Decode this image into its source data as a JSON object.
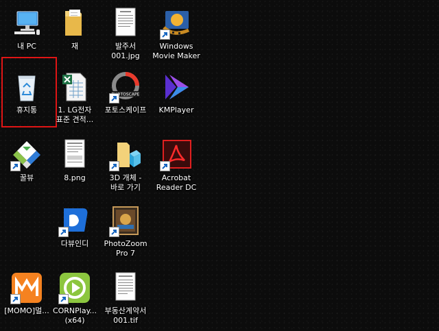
{
  "desktop": {
    "icons": [
      {
        "id": "this-pc",
        "label": "내 PC",
        "icon": "computer-icon"
      },
      {
        "id": "folder-jae",
        "label": "재",
        "icon": "folder-icon"
      },
      {
        "id": "balju",
        "label": "발주서\n001.jpg",
        "icon": "image-file-icon"
      },
      {
        "id": "movie-maker",
        "label": "Windows\nMovie Maker",
        "icon": "movie-maker-icon"
      },
      {
        "id": "recycle-bin",
        "label": "휴지통",
        "icon": "recycle-bin-icon"
      },
      {
        "id": "lg-xlsx",
        "label": "1. LG전자\n표준 견적...",
        "icon": "excel-file-icon"
      },
      {
        "id": "photoscape",
        "label": "포토스케이프",
        "icon": "photoscape-icon",
        "logo_text": "PHOTOSCAPE"
      },
      {
        "id": "kmplayer",
        "label": "KMPlayer",
        "icon": "kmplayer-icon"
      },
      {
        "id": "kkulview",
        "label": "꿀뷰",
        "icon": "honeyview-icon"
      },
      {
        "id": "png8",
        "label": "8.png",
        "icon": "image-file-icon"
      },
      {
        "id": "3d-objects",
        "label": "3D 개체 -\n바로 가기",
        "icon": "3d-objects-folder-icon"
      },
      {
        "id": "acrobat",
        "label": "Acrobat\nReader DC",
        "icon": "acrobat-icon"
      },
      {
        "id": "dayuindi",
        "label": "다뷰인디",
        "icon": "daview-icon"
      },
      {
        "id": "photozoom",
        "label": "PhotoZoom\nPro 7",
        "icon": "photozoom-icon"
      },
      {
        "id": "momo",
        "label": "[MOMO]멀...",
        "icon": "momo-icon"
      },
      {
        "id": "cornplayer",
        "label": "CORNPlay...\n(x64)",
        "icon": "cornplayer-icon"
      },
      {
        "id": "contract",
        "label": "부동산계약서\n001.tif",
        "icon": "document-file-icon"
      }
    ]
  }
}
